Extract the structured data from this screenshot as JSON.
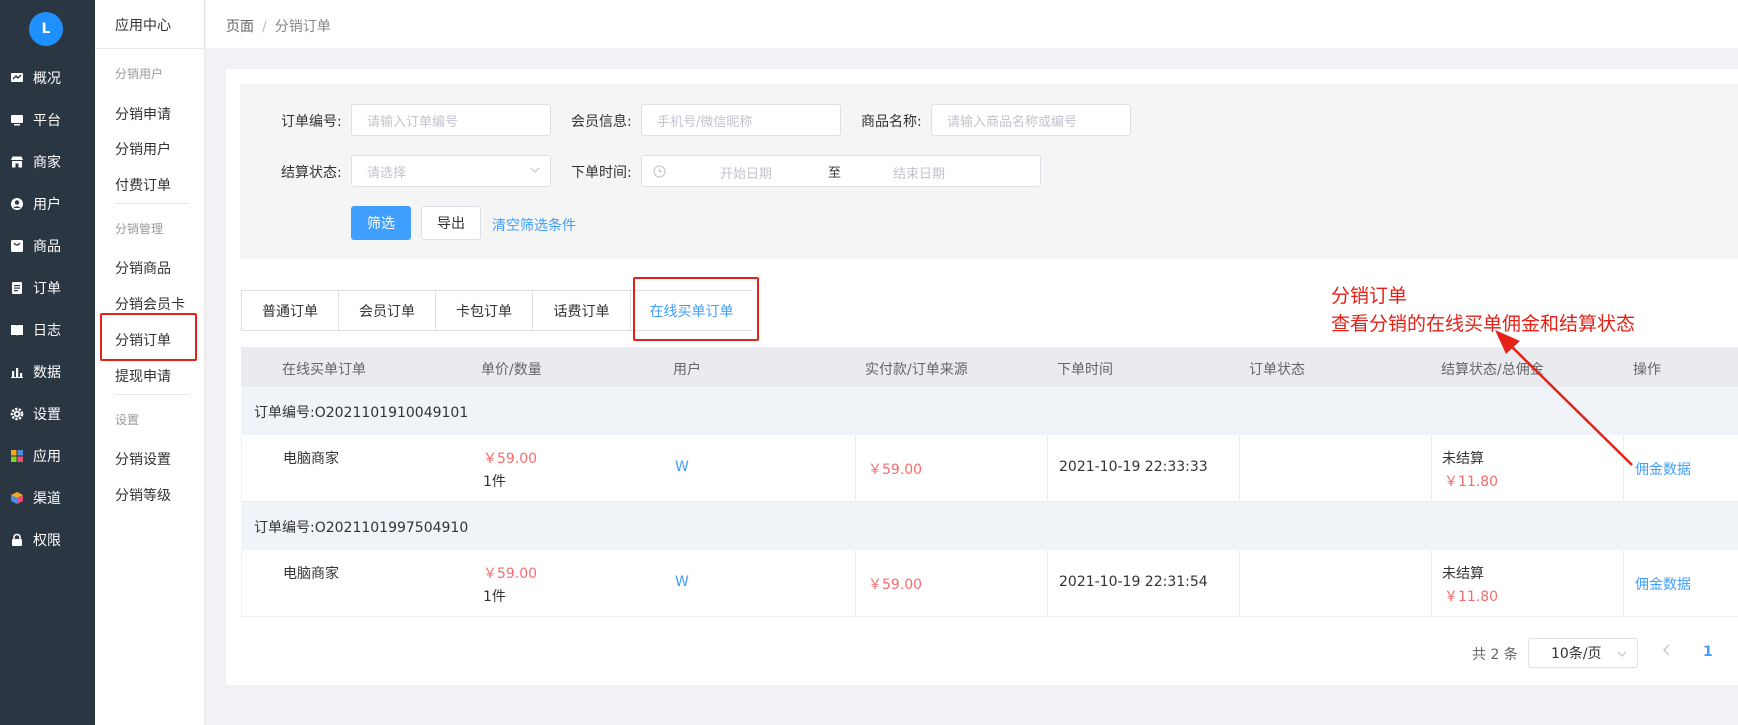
{
  "logo_text": "L",
  "nav": [
    {
      "label": "概况",
      "icon": "dashboard-icon"
    },
    {
      "label": "平台",
      "icon": "monitor-icon"
    },
    {
      "label": "商家",
      "icon": "store-icon"
    },
    {
      "label": "用户",
      "icon": "user-icon"
    },
    {
      "label": "商品",
      "icon": "product-icon"
    },
    {
      "label": "订单",
      "icon": "order-icon"
    },
    {
      "label": "日志",
      "icon": "book-icon"
    },
    {
      "label": "数据",
      "icon": "bar-chart-icon"
    },
    {
      "label": "设置",
      "icon": "gear-icon"
    },
    {
      "label": "应用",
      "icon": "apps-grid-icon"
    },
    {
      "label": "渠道",
      "icon": "cube-icon"
    },
    {
      "label": "权限",
      "icon": "lock-icon"
    }
  ],
  "submenu": {
    "title": "应用中心",
    "group1": "分销用户",
    "group1_items": [
      "分销申请",
      "分销用户",
      "付费订单"
    ],
    "group2": "分销管理",
    "group2_items": [
      "分销商品",
      "分销会员卡",
      "分销订单",
      "提现申请"
    ],
    "group3": "设置",
    "group3_items": [
      "分销设置",
      "分销等级"
    ]
  },
  "breadcrumb": {
    "root": "页面",
    "sep": "/",
    "current": "分销订单"
  },
  "filter": {
    "order_no_label": "订单编号:",
    "order_no_placeholder": "请输入订单编号",
    "member_label": "会员信息:",
    "member_placeholder": "手机号/微信昵称",
    "product_label": "商品名称:",
    "product_placeholder": "请输入商品名称或编号",
    "settle_label": "结算状态:",
    "settle_placeholder": "请选择",
    "time_label": "下单时间:",
    "start_placeholder": "开始日期",
    "range_sep": "至",
    "end_placeholder": "结束日期",
    "filter_btn": "筛选",
    "export_btn": "导出",
    "clear_link": "清空筛选条件"
  },
  "tabs": [
    "普通订单",
    "会员订单",
    "卡包订单",
    "话费订单",
    "在线买单订单"
  ],
  "table": {
    "headers": [
      "在线买单订单",
      "单价/数量",
      "用户",
      "实付款/订单来源",
      "下单时间",
      "订单状态",
      "结算状态/总佣金",
      "操作"
    ],
    "orders": [
      {
        "order_no": "订单编号:O2021101910049101",
        "product": "电脑商家",
        "price": "￥59.00",
        "qty": "1件",
        "user": "W",
        "paid": "￥59.00",
        "time": "2021-10-19 22:33:33",
        "settle": "未结算",
        "commission": "￥11.80",
        "action": "佣金数据"
      },
      {
        "order_no": "订单编号:O2021101997504910",
        "product": "电脑商家",
        "price": "￥59.00",
        "qty": "1件",
        "user": "W",
        "paid": "￥59.00",
        "time": "2021-10-19 22:31:54",
        "settle": "未结算",
        "commission": "￥11.80",
        "action": "佣金数据"
      }
    ]
  },
  "pagination": {
    "total": "共 2 条",
    "page_size": "10条/页",
    "current_page": "1"
  },
  "annotation": {
    "line1": "分销订单",
    "line2": "查看分销的在线买单佣金和结算状态"
  },
  "colors": {
    "sidebar_bg": "#2b3643",
    "primary": "#409eff",
    "annotation_red": "#e62117",
    "price_red": "#f56c6c"
  }
}
